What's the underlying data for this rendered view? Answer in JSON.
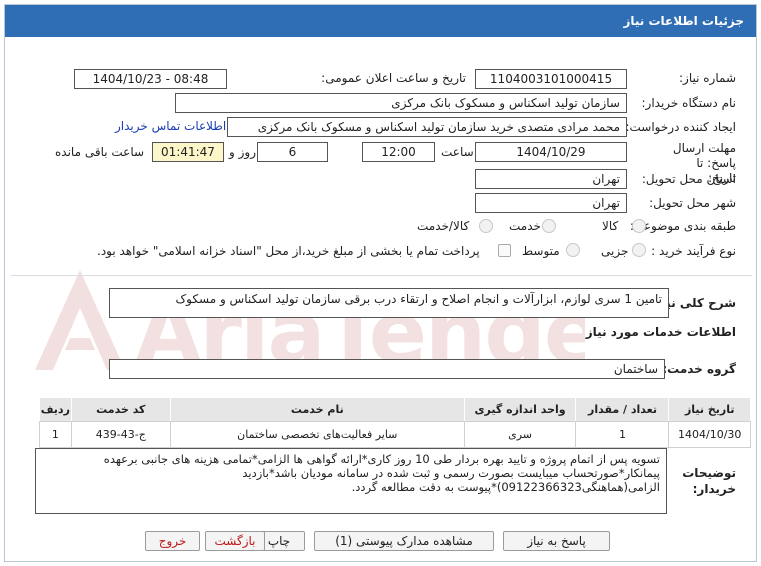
{
  "window": {
    "title": "جزئیات اطلاعات نیاز"
  },
  "fields": {
    "need_number_label": "شماره نیاز:",
    "need_number": "1104003101000415",
    "announce_label": "تاریخ و ساعت اعلان عمومی:",
    "announce_value": "1404/10/23 - 08:48",
    "buyer_org_label": "نام دستگاه خریدار:",
    "buyer_org": "سازمان تولید اسکناس و مسکوک بانک مرکزی",
    "requester_label": "ایجاد کننده درخواست:",
    "requester": "محمد مرادی متصدی خرید سازمان تولید اسکناس و مسکوک بانک مرکزی",
    "contact_link": "اطلاعات تماس خریدار",
    "deadline_label": "مهلت ارسال پاسخ: تا تاریخ:",
    "deadline_date": "1404/10/29",
    "hour_label": "ساعت",
    "deadline_time": "12:00",
    "days_value": "6",
    "days_label": "روز و",
    "remaining_time": "01:41:47",
    "remaining_label": "ساعت باقی مانده",
    "province_label": "استان محل تحویل:",
    "province": "تهران",
    "city_label": "شهر محل تحویل:",
    "city": "تهران",
    "category_label": "طبقه بندی موضوعی:",
    "category_options": [
      "کالا",
      "خدمت",
      "کالا/خدمت"
    ],
    "process_label": "نوع فرآیند خرید :",
    "process_options": [
      "جزیی",
      "متوسط"
    ],
    "payment_note": "پرداخت تمام یا بخشی از مبلغ خرید،از محل \"اسناد خزانه اسلامی\" خواهد بود."
  },
  "summary": {
    "label": "شرح کلی نیاز:",
    "value": "تامین 1 سری لوازم، ابزارآلات و انجام اصلاح و ارتقاء درب برقی سازمان تولید اسکناس و مسکوک"
  },
  "services": {
    "section_title": "اطلاعات خدمات مورد نیاز",
    "group_label": "گروه خدمت:",
    "group_value": "ساختمان",
    "columns": [
      "ردیف",
      "کد خدمت",
      "نام خدمت",
      "واحد اندازه گیری",
      "تعداد / مقدار",
      "تاریخ نیاز"
    ],
    "rows": [
      {
        "row": "1",
        "code": "ج-43-439",
        "name": "سایر فعالیت‌های تخصصی ساختمان",
        "unit": "سری",
        "qty": "1",
        "date": "1404/10/30"
      }
    ]
  },
  "notes": {
    "label": "توضیحات خریدار:",
    "text": "تسویه پس از اتمام پروژه و تایید بهره بردار طی 10 روز کاری*ارائه گواهی ها الزامی*تمامی هزینه های جانبی برعهده پیمانکار*صورتحساب میبایست بصورت رسمی و ثبت شده در سامانه مودیان باشد*بازدید الزامی(هماهنگی09122366323)*پیوست به دقت مطالعه گردد."
  },
  "buttons": {
    "reply": "پاسخ به نیاز",
    "attachments": "مشاهده مدارک پیوستی (1)",
    "print": "چاپ",
    "back": "بازگشت",
    "exit": "خروج"
  },
  "watermark": {
    "text": "AriaTender.net"
  },
  "colors": {
    "titlebar": "#2f6eb5",
    "timer_bg": "#fdf6c9",
    "link": "#1a3db5",
    "exit_text": "#c01818"
  }
}
